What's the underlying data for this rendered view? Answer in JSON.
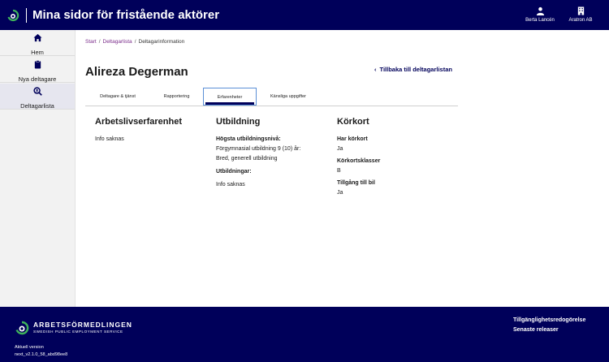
{
  "header": {
    "title": "Mina sidor för fristående aktörer",
    "user_name": "Berta Lancén",
    "org_name": "Aratron AB",
    "logo_icon": "af-logo-icon",
    "user_icon": "person-icon",
    "org_icon": "building-icon"
  },
  "sidebar": {
    "items": [
      {
        "label": "Hem",
        "icon": "home-icon"
      },
      {
        "label": "Nya deltagare",
        "icon": "clipboard-icon"
      },
      {
        "label": "Deltagarlista",
        "icon": "search-person-icon"
      }
    ]
  },
  "breadcrumb": {
    "items": [
      "Start",
      "Deltagarlista",
      "Deltagarinformation"
    ],
    "separator": "/"
  },
  "page": {
    "title": "Alireza Degerman",
    "back_link": "Tillbaka till deltagarlistan"
  },
  "tabs": [
    "Deltagare & tjänst",
    "Rapportering",
    "Erfarenheter",
    "Känsliga uppgifter"
  ],
  "active_tab": "Erfarenheter",
  "sections": {
    "work": {
      "heading": "Arbetslivserfarenhet",
      "text": "Info saknas"
    },
    "education": {
      "heading": "Utbildning",
      "level_label": "Högsta utbildningsnivå:",
      "level_value_line1": "Förgymnasial utbildning 9 (10) år:",
      "level_value_line2": "Bred, generell utbildning",
      "educations_label": "Utbildningar:",
      "educations_value": "Info saknas"
    },
    "license": {
      "heading": "Körkort",
      "has_license_label": "Har körkort",
      "has_license_value": "Ja",
      "classes_label": "Körkortsklasser",
      "classes_value": "B",
      "car_access_label": "Tillgång till bil",
      "car_access_value": "Ja"
    }
  },
  "footer": {
    "brand": "ARBETSFÖRMEDLINGEN",
    "brand_sub": "SWEDISH PUBLIC EMPLOYMENT SERVICE",
    "version_label": "Aktuell version",
    "version_value": "next_v2.1.0_58_abd98ee8",
    "links": [
      "Tillgänglighetsredogörelse",
      "Senaste releaser"
    ]
  },
  "colors": {
    "brand_navy": "#00005a",
    "link_purple": "#7a2c8a",
    "sidebar_bg": "#f2f2f2",
    "tab_focus": "#5b8fd6"
  }
}
